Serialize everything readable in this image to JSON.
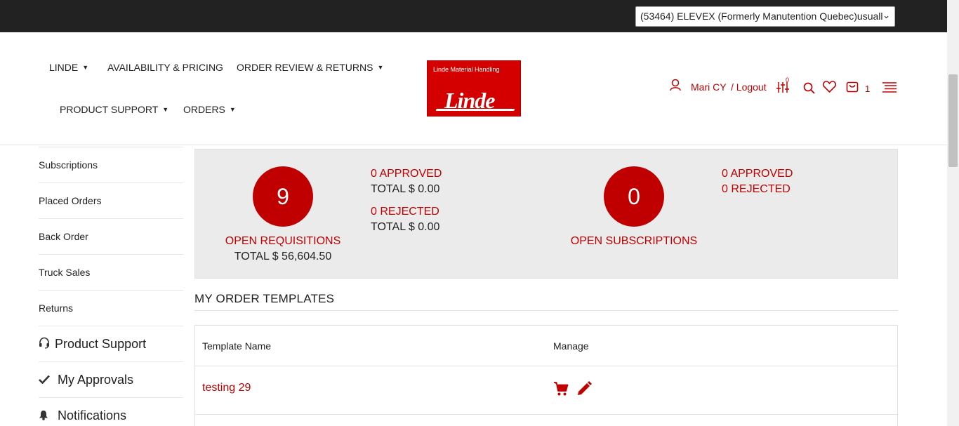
{
  "account_selector": {
    "value": "(53464) ELEVEX (Formerly Manutention Quebec)usuall"
  },
  "nav": {
    "linde": "LINDE",
    "availability": "AVAILABILITY & PRICING",
    "order_review": "ORDER REVIEW & RETURNS",
    "product_support": "PRODUCT SUPPORT",
    "orders": "ORDERS"
  },
  "logo": {
    "subtitle": "Linde Material Handling",
    "brand": "Linde"
  },
  "user": {
    "name": "Mari CY",
    "logout": "/ Logout",
    "compare_count": "0",
    "cart_count": "1"
  },
  "sidebar": {
    "items": [
      {
        "label": "Subscriptions"
      },
      {
        "label": "Placed Orders"
      },
      {
        "label": "Back Order"
      },
      {
        "label": "Truck Sales"
      },
      {
        "label": "Returns"
      },
      {
        "label": "Product Support",
        "icon": "headset-icon"
      },
      {
        "label": "My Approvals",
        "icon": "check-icon"
      },
      {
        "label": "Notifications",
        "icon": "bell-icon"
      }
    ]
  },
  "stats": {
    "requisitions": {
      "count": "9",
      "label": "OPEN REQUISITIONS",
      "total": "TOTAL $ 56,604.50",
      "approved": "0 APPROVED",
      "approved_total": "TOTAL $ 0.00",
      "rejected": "0 REJECTED",
      "rejected_total": "TOTAL $ 0.00"
    },
    "subscriptions": {
      "count": "0",
      "label": "OPEN SUBSCRIPTIONS",
      "approved": "0 APPROVED",
      "rejected": "0 REJECTED"
    }
  },
  "templates": {
    "title": "MY ORDER TEMPLATES",
    "columns": [
      "Template Name",
      "Manage"
    ],
    "rows": [
      {
        "name": "testing 29"
      }
    ]
  },
  "colors": {
    "accent": "#c00000",
    "topbar": "#222222",
    "panel": "#ebebeb"
  }
}
